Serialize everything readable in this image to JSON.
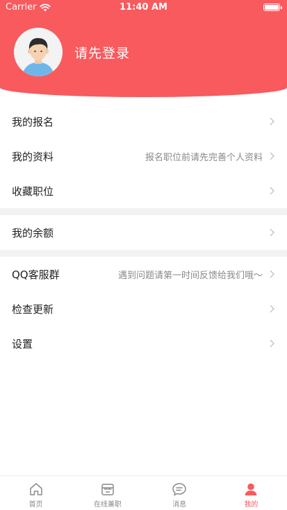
{
  "status_bar": {
    "carrier": "Carrier",
    "time": "11:40 AM"
  },
  "profile": {
    "login_prompt": "请先登录"
  },
  "menu": {
    "my_signups": {
      "label": "我的报名"
    },
    "my_profile": {
      "label": "我的资料",
      "hint": "报名职位前请先完善个人资料"
    },
    "favorite_jobs": {
      "label": "收藏职位"
    },
    "my_balance": {
      "label": "我的余额"
    },
    "qq_group": {
      "label": "QQ客服群",
      "hint": "遇到问题请第一时间反馈给我们哦～"
    },
    "check_update": {
      "label": "检查更新"
    },
    "settings": {
      "label": "设置"
    }
  },
  "tabbar": {
    "tabs": [
      {
        "label": "首页",
        "icon": "home-icon"
      },
      {
        "label": "在线兼职",
        "icon": "store-icon"
      },
      {
        "label": "消息",
        "icon": "message-icon"
      },
      {
        "label": "我的",
        "icon": "profile-icon",
        "active": true
      }
    ]
  },
  "colors": {
    "accent": "#f85a5e",
    "hint": "#8a8a8a",
    "divider": "#f2f2f2"
  }
}
